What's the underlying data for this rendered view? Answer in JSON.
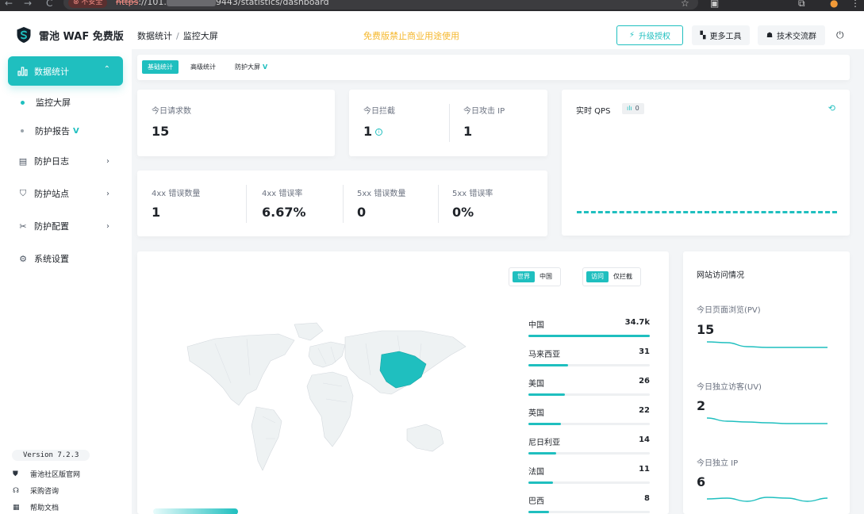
{
  "browser": {
    "nav": [
      "←",
      "→",
      "C"
    ],
    "security_label": "不安全",
    "url_scheme": "https",
    "url_prefix": "://101.",
    "url_suffix": "9443/statistics/dashboard"
  },
  "brand": {
    "title": "雷池 WAF 免费版"
  },
  "sidebar": {
    "active_group": "数据统计",
    "sub_items": [
      {
        "label": "监控大屏",
        "active": true
      },
      {
        "label": "防护报告",
        "badge": "V"
      }
    ],
    "items": [
      {
        "label": "防护日志",
        "icon": "log-icon",
        "has_children": true
      },
      {
        "label": "防护站点",
        "icon": "shield-icon",
        "has_children": true
      },
      {
        "label": "防护配置",
        "icon": "tools-icon",
        "has_children": true
      },
      {
        "label": "系统设置",
        "icon": "gear-icon",
        "has_children": false
      }
    ],
    "version": "Version 7.2.3",
    "footer_links": [
      {
        "label": "雷池社区版官网",
        "icon": "shield-icon"
      },
      {
        "label": "采购咨询",
        "icon": "headset-icon"
      },
      {
        "label": "帮助文档",
        "icon": "doc-icon"
      }
    ]
  },
  "header": {
    "breadcrumb": [
      "数据统计",
      "监控大屏"
    ],
    "notice": "免费版禁止商业用途使用",
    "upgrade_label": "升级授权",
    "tools_label": "更多工具",
    "community_label": "技术交流群"
  },
  "tabs": [
    {
      "label": "基础统计",
      "active": true
    },
    {
      "label": "高级统计",
      "active": false
    },
    {
      "label": "防护大屏",
      "active": false,
      "badge": "V"
    }
  ],
  "stats": {
    "requests": {
      "label": "今日请求数",
      "value": "15"
    },
    "blocked": {
      "label": "今日拦截",
      "value": "1"
    },
    "attack_ip": {
      "label": "今日攻击 IP",
      "value": "1"
    },
    "errors": [
      {
        "label": "4xx 错误数量",
        "value": "1"
      },
      {
        "label": "4xx 错误率",
        "value": "6.67%"
      },
      {
        "label": "5xx 错误数量",
        "value": "0"
      },
      {
        "label": "5xx 错误率",
        "value": "0%"
      }
    ]
  },
  "qps": {
    "label": "实时 QPS",
    "value": "0"
  },
  "map": {
    "scope": [
      "世界",
      "中国"
    ],
    "scope_selected": "世界",
    "mode": [
      "访问",
      "仅拦截"
    ],
    "mode_selected": "访问",
    "highlight_country": "中国",
    "countries": [
      {
        "name": "中国",
        "count": "34.7k",
        "share": 1.0
      },
      {
        "name": "马来西亚",
        "count": "31",
        "share": 0.33
      },
      {
        "name": "美国",
        "count": "26",
        "share": 0.3
      },
      {
        "name": "英国",
        "count": "22",
        "share": 0.27
      },
      {
        "name": "尼日利亚",
        "count": "14",
        "share": 0.23
      },
      {
        "name": "法国",
        "count": "11",
        "share": 0.2
      },
      {
        "name": "巴西",
        "count": "8",
        "share": 0.17
      }
    ]
  },
  "traffic": {
    "title": "网站访问情况",
    "metrics": [
      {
        "label": "今日页面浏览(PV)",
        "value": "15",
        "trend": [
          0.9,
          0.85,
          0.6,
          0.55,
          0.55,
          0.55,
          0.55
        ]
      },
      {
        "label": "今日独立访客(UV)",
        "value": "2",
        "trend": [
          0.9,
          0.7,
          0.65,
          0.6,
          0.55,
          0.55,
          0.55
        ]
      },
      {
        "label": "今日独立 IP",
        "value": "6",
        "trend": [
          0.55,
          0.6,
          0.4,
          0.65,
          0.6,
          0.4,
          0.6
        ]
      }
    ]
  },
  "colors": {
    "accent": "#1fbfbf",
    "notice": "#f5b82e",
    "map_land": "#eef2f3",
    "map_border": "#d4d9de"
  }
}
